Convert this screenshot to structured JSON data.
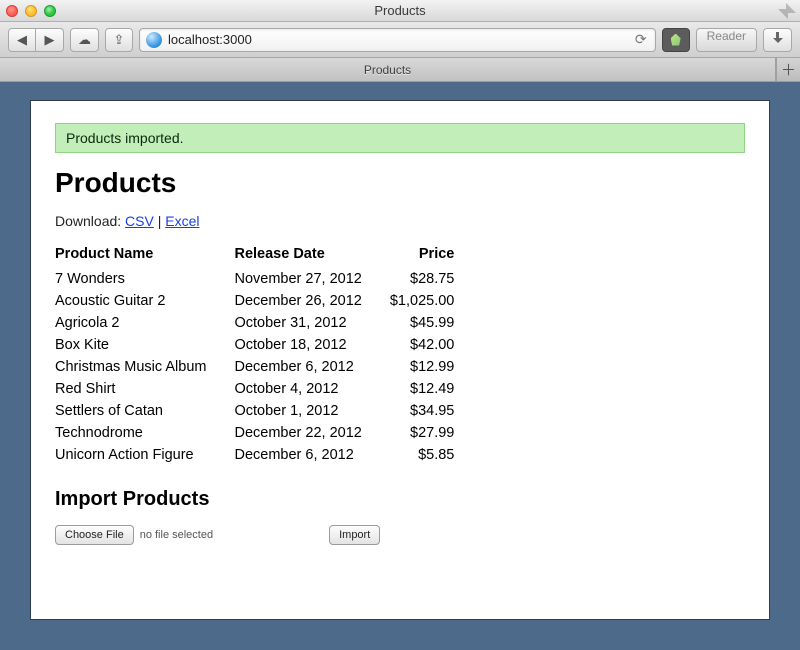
{
  "window": {
    "title": "Products"
  },
  "browser": {
    "url": "localhost:3000",
    "reader_label": "Reader",
    "tab_label": "Products"
  },
  "flash": {
    "message": "Products imported."
  },
  "page": {
    "title": "Products",
    "download_label": "Download:",
    "download_sep": " | ",
    "csv_label": "CSV",
    "excel_label": "Excel"
  },
  "table": {
    "headers": {
      "name": "Product Name",
      "date": "Release Date",
      "price": "Price"
    },
    "rows": [
      {
        "name": "7 Wonders",
        "date": "November 27, 2012",
        "price": "$28.75"
      },
      {
        "name": "Acoustic Guitar 2",
        "date": "December 26, 2012",
        "price": "$1,025.00"
      },
      {
        "name": "Agricola 2",
        "date": "October 31, 2012",
        "price": "$45.99"
      },
      {
        "name": "Box Kite",
        "date": "October 18, 2012",
        "price": "$42.00"
      },
      {
        "name": "Christmas Music Album",
        "date": "December 6, 2012",
        "price": "$12.99"
      },
      {
        "name": "Red Shirt",
        "date": "October 4, 2012",
        "price": "$12.49"
      },
      {
        "name": "Settlers of Catan",
        "date": "October 1, 2012",
        "price": "$34.95"
      },
      {
        "name": "Technodrome",
        "date": "December 22, 2012",
        "price": "$27.99"
      },
      {
        "name": "Unicorn Action Figure",
        "date": "December 6, 2012",
        "price": "$5.85"
      }
    ]
  },
  "import": {
    "title": "Import Products",
    "choose_label": "Choose File",
    "file_status": "no file selected",
    "submit_label": "Import"
  }
}
